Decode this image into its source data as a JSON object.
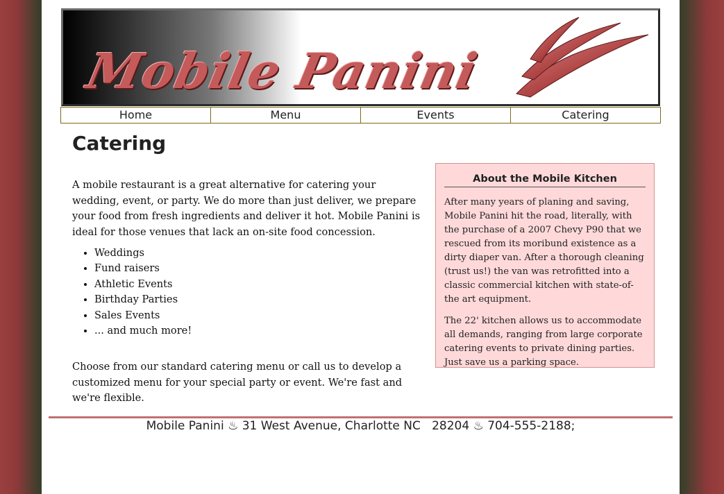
{
  "banner": {
    "logo_text": "Mobile Panini"
  },
  "nav": {
    "items": [
      "Home",
      "Menu",
      "Events",
      "Catering"
    ]
  },
  "page_title": "Catering",
  "main": {
    "intro": "A mobile restaurant is a great alternative for catering your wedding, event, or party. We do more than just deliver, we prepare your food from fresh ingredients and deliver it hot. Mobile Panini is ideal for those venues that lack an on-site food concession.",
    "list": [
      "Weddings",
      "Fund raisers",
      "Athletic Events",
      "Birthday Parties",
      "Sales Events",
      "... and much more!"
    ],
    "closing": "Choose from our standard catering menu or call us to develop a customized menu for your special party or event. We're fast and we're flexible."
  },
  "aside": {
    "title": "About the Mobile Kitchen",
    "p1": "After many years of planing and saving, Mobile Panini hit the road, literally, with the purchase of a 2007 Chevy P90 that we rescued from its moribund existence as a dirty diaper van. After a thorough cleaning (trust us!) the van was retrofitted into a classic commercial kitchen with state-of-the art equipment.",
    "p2": "The 22' kitchen allows us to accommodate all demands, ranging from large corporate catering events to private dining parties. Just save us a parking space."
  },
  "footer": {
    "text": "Mobile Panini ♨ 31 West Avenue, Charlotte NC   28204 ♨ 704-555-2188;"
  },
  "colors": {
    "accent": "#c55a5a",
    "aside_bg": "#ffd9da",
    "nav_border": "#7a6a1a"
  }
}
